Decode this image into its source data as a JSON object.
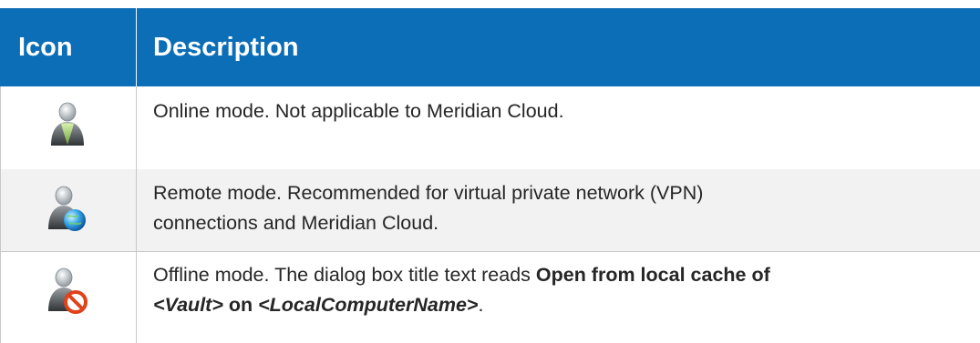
{
  "header": {
    "icon_label": "Icon",
    "description_label": "Description"
  },
  "rows": [
    {
      "icon": "user-online-icon",
      "text": "Online mode. Not applicable to Meridian Cloud."
    },
    {
      "icon": "user-remote-globe-icon",
      "text_line1": "Remote mode. Recommended for virtual private network (VPN)",
      "text_line2": "connections and Meridian Cloud."
    },
    {
      "icon": "user-offline-noentry-icon",
      "text_prefix": "Offline mode. The dialog box title text reads ",
      "bold_1": "Open from local cache of",
      "bold_vault": "<Vault>",
      "bold_on": " on ",
      "bold_computer": "<LocalComputerName>",
      "text_suffix": "."
    }
  ],
  "colors": {
    "header_bg": "#0d6eb8",
    "alt_row_bg": "#f2f2f2",
    "border": "#c8c8c8"
  }
}
